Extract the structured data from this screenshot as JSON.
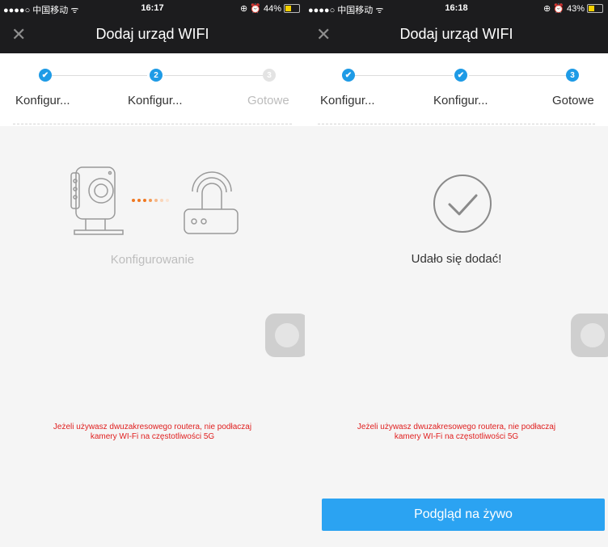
{
  "left": {
    "status": {
      "signal": "●●●●○ 中国移动 ᯤ",
      "time": "16:17",
      "battery": "⊕ ⏰ 44%",
      "battery_level": 0.44
    },
    "nav": {
      "title": "Dodaj urząd WIFI",
      "close_icon": "close-icon"
    },
    "steps": [
      {
        "label": "Konfigur...",
        "state": "done",
        "mark": "✔"
      },
      {
        "label": "Konfigur...",
        "state": "current",
        "mark": "2"
      },
      {
        "label": "Gotowe",
        "state": "pending",
        "mark": "3"
      }
    ],
    "status_text": "Konfigurowanie",
    "warning_line1": "Jeżeli używasz dwuzakresowego routera, nie podłaczaj",
    "warning_line2": "kamery WI-Fi na częstotliwości 5G"
  },
  "right": {
    "status": {
      "signal": "●●●●○ 中国移动 ᯤ",
      "time": "16:18",
      "battery": "⊕ ⏰ 43%",
      "battery_level": 0.43
    },
    "nav": {
      "title": "Dodaj urząd WIFI",
      "close_icon": "close-icon"
    },
    "steps": [
      {
        "label": "Konfigur...",
        "state": "done",
        "mark": "✔"
      },
      {
        "label": "Konfigur...",
        "state": "done",
        "mark": "✔"
      },
      {
        "label": "Gotowe",
        "state": "current",
        "mark": "3"
      }
    ],
    "success_text": "Udało się dodać!",
    "warning_line1": "Jeżeli używasz dwuzakresowego routera, nie podłaczaj",
    "warning_line2": "kamery WI-Fi na częstotliwości 5G",
    "live_button": "Podgląd na żywo"
  },
  "colors": {
    "accent": "#1e9be6",
    "warning": "#e02020",
    "button": "#2ba3f2",
    "connecting_dots": "#f07820"
  }
}
